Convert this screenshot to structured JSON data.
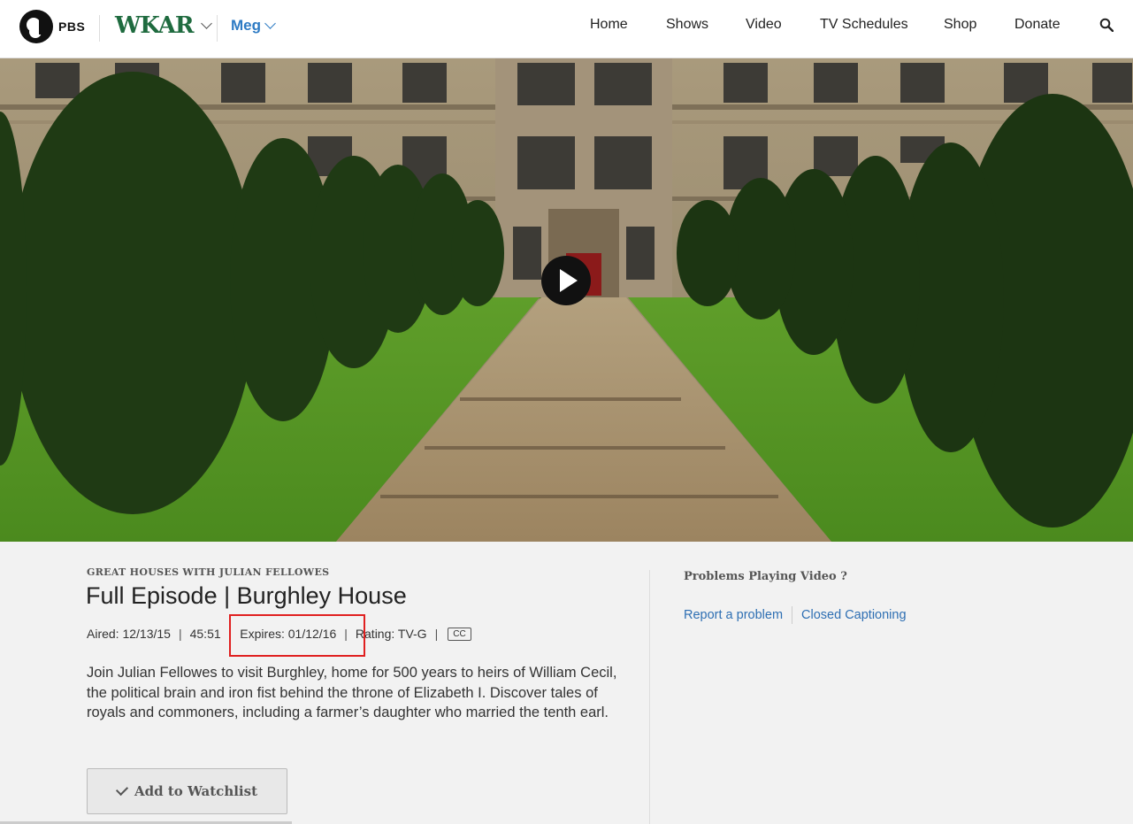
{
  "header": {
    "pbs_label": "PBS",
    "station": "WKAR",
    "user": "Meg",
    "nav": [
      "Home",
      "Shows",
      "Video",
      "TV Schedules",
      "Shop",
      "Donate"
    ]
  },
  "video": {
    "show_name": "GREAT HOUSES WITH JULIAN FELLOWES",
    "title": "Full Episode | Burghley House",
    "aired": "Aired: 12/13/15",
    "duration": "45:51",
    "expires": "Expires: 01/12/16",
    "rating": "Rating: TV-G",
    "cc": "CC",
    "description": "Join Julian Fellowes to visit Burghley, home for 500 years to heirs of William Cecil, the political brain and iron fist behind the throne of Elizabeth I. Discover tales of royals and commoners, including a farmer’s daughter who married the tenth earl.",
    "watchlist_label": "Add to Watchlist"
  },
  "sidebar": {
    "problems_title": "Problems Playing Video ?",
    "report_link": "Report a problem",
    "cc_link": "Closed Captioning"
  },
  "colors": {
    "station_green": "#1f6b3f",
    "link_blue": "#2e6fb3",
    "highlight_red": "#e02020"
  }
}
